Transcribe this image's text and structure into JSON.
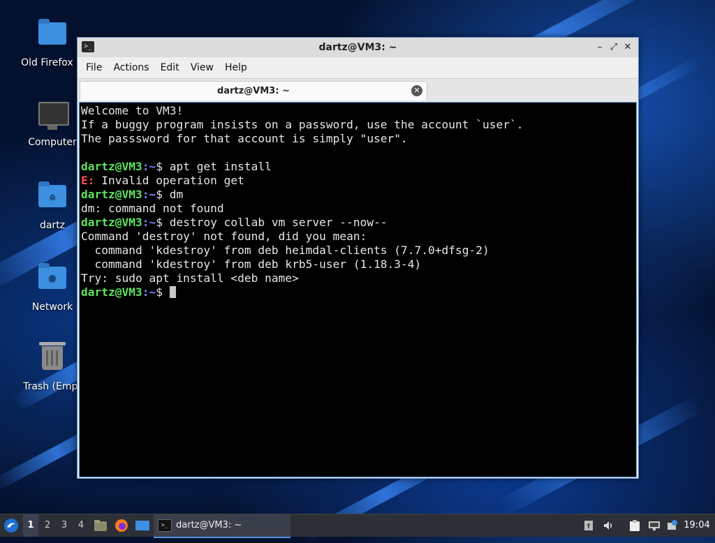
{
  "desktop": {
    "icons": [
      {
        "label": "Old Firefox D"
      },
      {
        "label": "Computer"
      },
      {
        "label": "dartz"
      },
      {
        "label": "Network"
      },
      {
        "label": "Trash (Empt"
      }
    ]
  },
  "window": {
    "title": "dartz@VM3: ~",
    "menu": [
      "File",
      "Actions",
      "Edit",
      "View",
      "Help"
    ],
    "tab_label": "dartz@VM3: ~",
    "terminal": {
      "welcome": [
        "Welcome to VM3!",
        "If a buggy program insists on a password, use the account `user`.",
        "The passsword for that account is simply \"user\"."
      ],
      "prompt_user": "dartz@VM3",
      "prompt_path": ":~",
      "prompt_symbol": "$",
      "cmd1": " apt get install",
      "err_prefix": "E:",
      "err_text": " Invalid operation get",
      "cmd2": " dm",
      "out2": "dm: command not found",
      "cmd3": " destroy collab vm server --now--",
      "out3": [
        "Command 'destroy' not found, did you mean:",
        "  command 'kdestroy' from deb heimdal-clients (7.7.0+dfsg-2)",
        "  command 'kdestroy' from deb krb5-user (1.18.3-4)",
        "Try: sudo apt install <deb name>"
      ]
    }
  },
  "taskbar": {
    "workspaces": [
      "1",
      "2",
      "3",
      "4"
    ],
    "task_label": "dartz@VM3: ~",
    "clock": "19:04"
  },
  "colors": {
    "prompt_user": "#5fe35f",
    "prompt_path": "#7a8cff",
    "error": "#ff4d4d",
    "accent": "#4a90e2"
  }
}
